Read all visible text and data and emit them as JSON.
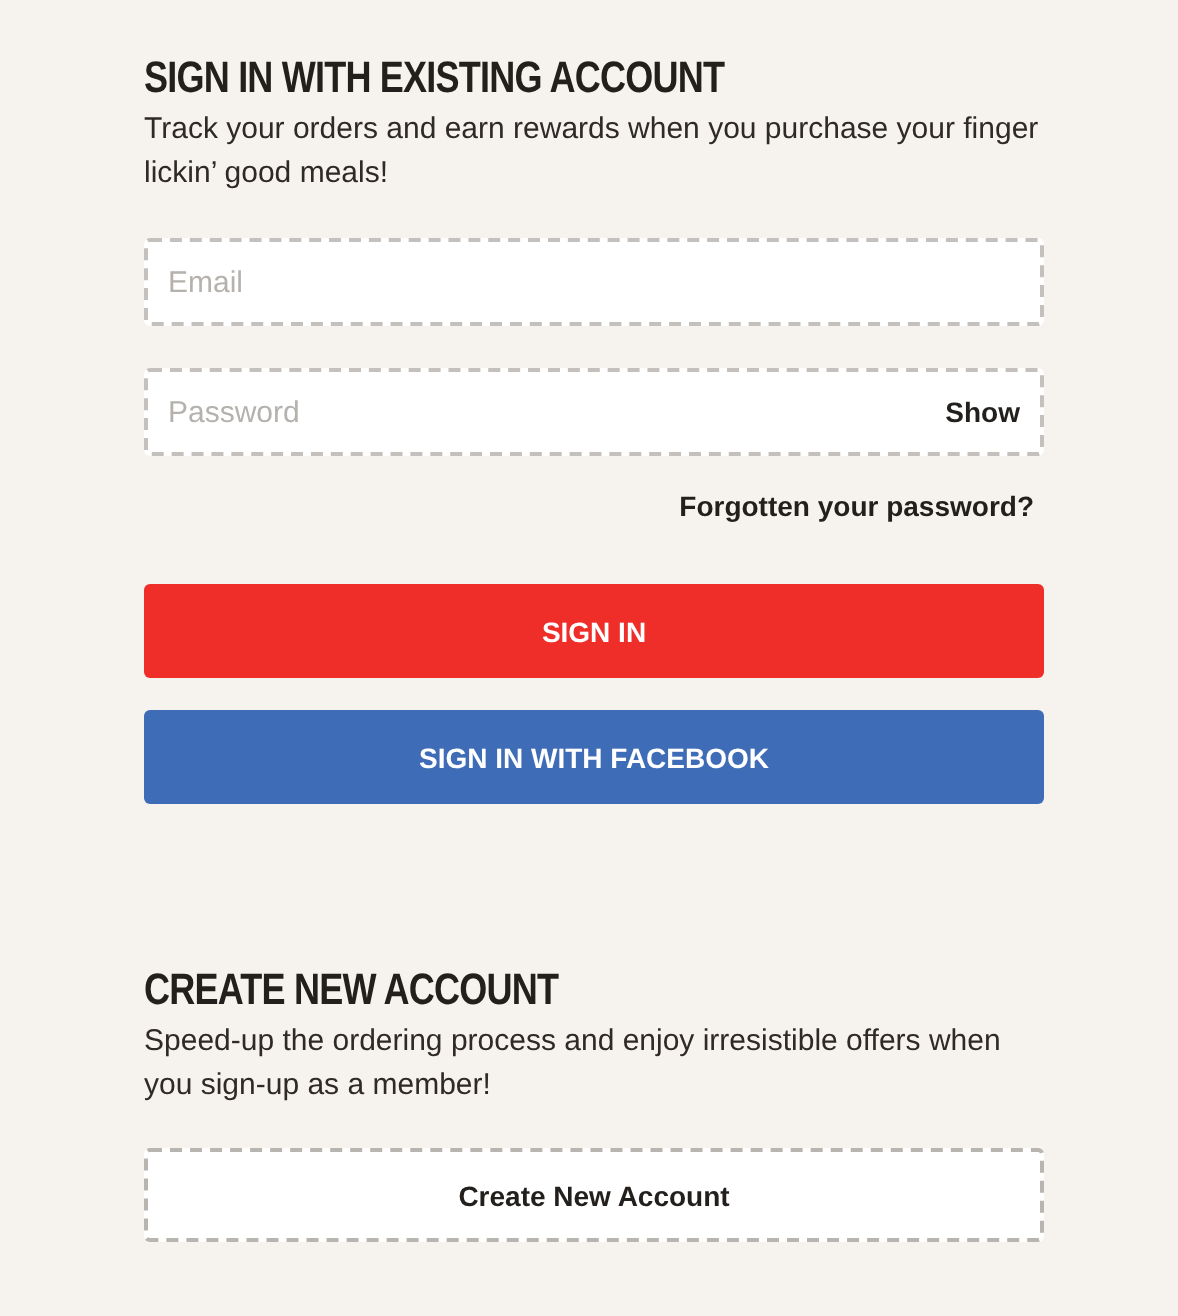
{
  "sign_in": {
    "heading": "SIGN IN WITH EXISTING ACCOUNT",
    "description": "Track your orders and earn rewards when you purchase your finger lickin’ good meals!",
    "email_field": {
      "placeholder": "Email"
    },
    "password_field": {
      "placeholder": "Password",
      "toggle": "Show"
    },
    "forgot_link": "Forgotten your password?",
    "buttons": [
      {
        "label": "SIGN IN",
        "kind": "primary"
      },
      {
        "label": "SIGN IN WITH FACEBOOK",
        "kind": "facebook"
      }
    ]
  },
  "create": {
    "heading": "CREATE NEW ACCOUNT",
    "description": "Speed-up the ordering process and enjoy irresistible offers when you sign-up as a member!",
    "button": "Create New Account"
  }
}
